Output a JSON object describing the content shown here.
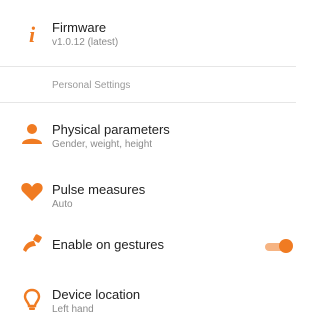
{
  "accent_color": "#f07b22",
  "firmware": {
    "icon": "info-icon",
    "title": "Firmware",
    "subtitle": "v1.0.12 (latest)"
  },
  "section_header": "Personal Settings",
  "items": [
    {
      "icon": "person-icon",
      "title": "Physical parameters",
      "subtitle": "Gender, weight, height"
    },
    {
      "icon": "heart-icon",
      "title": "Pulse measures",
      "subtitle": "Auto"
    },
    {
      "icon": "gesture-icon",
      "title": "Enable on gestures",
      "toggle_on": true
    },
    {
      "icon": "location-pin-icon",
      "title": "Device location",
      "subtitle": "Left hand"
    }
  ]
}
